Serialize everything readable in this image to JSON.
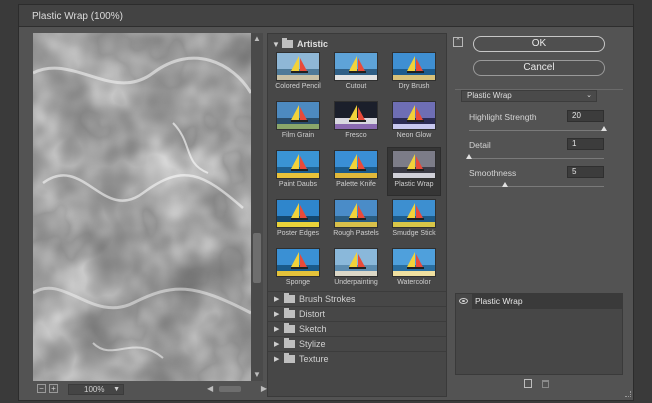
{
  "window": {
    "title": "Plastic Wrap (100%)"
  },
  "preview": {
    "zoom": "100%",
    "zoom_in_label": "+",
    "zoom_out_label": "−"
  },
  "gallery": {
    "category": "Artistic",
    "thumbs": [
      {
        "label": "Colored Pencil"
      },
      {
        "label": "Cutout"
      },
      {
        "label": "Dry Brush"
      },
      {
        "label": "Film Grain"
      },
      {
        "label": "Fresco"
      },
      {
        "label": "Neon Glow"
      },
      {
        "label": "Paint Daubs"
      },
      {
        "label": "Palette Knife"
      },
      {
        "label": "Plastic Wrap"
      },
      {
        "label": "Poster Edges"
      },
      {
        "label": "Rough Pastels"
      },
      {
        "label": "Smudge Stick"
      },
      {
        "label": "Sponge"
      },
      {
        "label": "Underpainting"
      },
      {
        "label": "Watercolor"
      }
    ],
    "selected": "Plastic Wrap",
    "categories": [
      "Brush Strokes",
      "Distort",
      "Sketch",
      "Stylize",
      "Texture"
    ]
  },
  "buttons": {
    "ok": "OK",
    "cancel": "Cancel"
  },
  "filter": {
    "selected": "Plastic Wrap",
    "params": [
      {
        "label": "Highlight Strength",
        "value": "20",
        "fraction": 1.0
      },
      {
        "label": "Detail",
        "value": "1",
        "fraction": 0.0
      },
      {
        "label": "Smoothness",
        "value": "5",
        "fraction": 0.27
      }
    ]
  },
  "layers": {
    "items": [
      {
        "label": "Plastic Wrap"
      }
    ]
  },
  "colors": {
    "bg": "#535353",
    "panel": "#474747",
    "accent": "#e0e0e0"
  }
}
